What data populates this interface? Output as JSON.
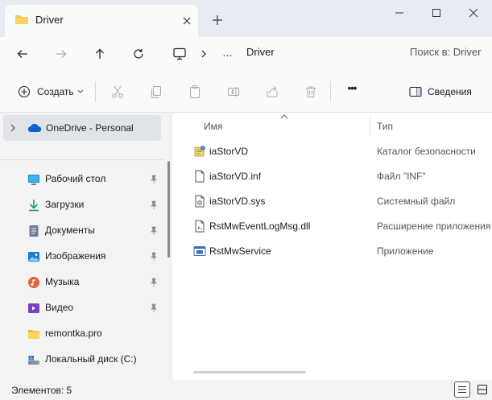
{
  "window": {
    "tab_title": "Driver",
    "accent_color": "#005fb8"
  },
  "address": {
    "crumb": "Driver",
    "ellipsis": "…",
    "search_placeholder": "Поиск в: Driver"
  },
  "toolbar": {
    "create_label": "Создать",
    "more_label": "•••",
    "details_label": "Сведения"
  },
  "nav": {
    "onedrive": "OneDrive - Personal",
    "items": [
      {
        "label": "Рабочий стол",
        "icon": "desktop-icon",
        "pinned": true
      },
      {
        "label": "Загрузки",
        "icon": "download-icon",
        "pinned": true
      },
      {
        "label": "Документы",
        "icon": "documents-icon",
        "pinned": true
      },
      {
        "label": "Изображения",
        "icon": "pictures-icon",
        "pinned": true
      },
      {
        "label": "Музыка",
        "icon": "music-icon",
        "pinned": true
      },
      {
        "label": "Видео",
        "icon": "video-icon",
        "pinned": true
      },
      {
        "label": "remontka.pro",
        "icon": "folder-icon",
        "pinned": false
      },
      {
        "label": "Локальный диск (C:)",
        "icon": "drive-icon",
        "pinned": false
      }
    ]
  },
  "files": {
    "columns": {
      "name": "Имя",
      "type": "Тип"
    },
    "rows": [
      {
        "name": "iaStorVD",
        "type": "Каталог безопасности",
        "icon": "security-catalog-icon"
      },
      {
        "name": "iaStorVD.inf",
        "type": "Файл \"INF\"",
        "icon": "inf-file-icon"
      },
      {
        "name": "iaStorVD.sys",
        "type": "Системный файл",
        "icon": "system-file-icon"
      },
      {
        "name": "RstMwEventLogMsg.dll",
        "type": "Расширение приложения",
        "icon": "dll-file-icon"
      },
      {
        "name": "RstMwService",
        "type": "Приложение",
        "icon": "application-icon"
      }
    ]
  },
  "status": {
    "count_text": "Элементов: 5"
  }
}
